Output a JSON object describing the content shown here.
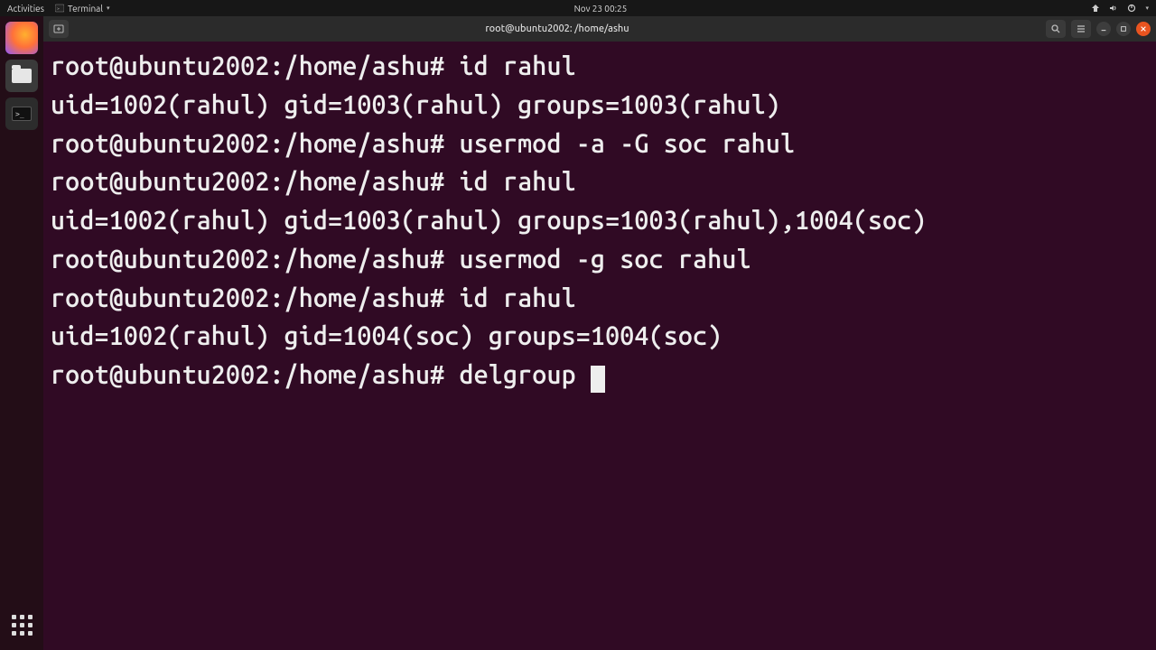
{
  "top_panel": {
    "activities": "Activities",
    "app_menu": "Terminal",
    "clock": "Nov 23  00:25"
  },
  "window": {
    "title": "root@ubuntu2002: /home/ashu"
  },
  "terminal": {
    "prompt": "root@ubuntu2002:/home/ashu#",
    "lines": [
      {
        "type": "cmd",
        "text": "id rahul"
      },
      {
        "type": "out",
        "text": "uid=1002(rahul) gid=1003(rahul) groups=1003(rahul)"
      },
      {
        "type": "cmd",
        "text": "usermod -a -G soc rahul"
      },
      {
        "type": "cmd",
        "text": "id rahul"
      },
      {
        "type": "out",
        "text": "uid=1002(rahul) gid=1003(rahul) groups=1003(rahul),1004(soc)"
      },
      {
        "type": "cmd",
        "text": "usermod -g soc rahul"
      },
      {
        "type": "cmd",
        "text": "id rahul"
      },
      {
        "type": "out",
        "text": "uid=1002(rahul) gid=1004(soc) groups=1004(soc)"
      }
    ],
    "current_input": "delgroup "
  }
}
